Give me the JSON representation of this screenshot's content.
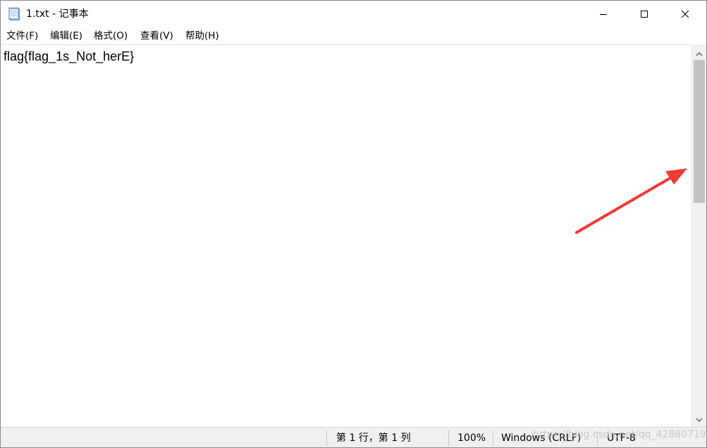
{
  "window": {
    "title": "1.txt - 记事本",
    "icon": "notepad-icon",
    "controls": {
      "minimize": "minimize-icon",
      "maximize": "maximize-icon",
      "close": "close-icon"
    }
  },
  "menu": {
    "items": [
      {
        "label": "文件(F)"
      },
      {
        "label": "编辑(E)"
      },
      {
        "label": "格式(O)"
      },
      {
        "label": "查看(V)"
      },
      {
        "label": "帮助(H)"
      }
    ]
  },
  "editor": {
    "content": "flag{flag_1s_Not_herE}"
  },
  "status": {
    "position": "第 1 行，第 1 列",
    "zoom": "100%",
    "line_ending": "Windows (CRLF)",
    "encoding": "UTF-8"
  },
  "watermark": {
    "text": "https://blog.csdn.net/qq_42880719"
  },
  "colors": {
    "annotation_arrow": "#f03a35",
    "scroll_thumb": "#c2c2c2",
    "statusbar_bg": "#f0f0f0"
  }
}
